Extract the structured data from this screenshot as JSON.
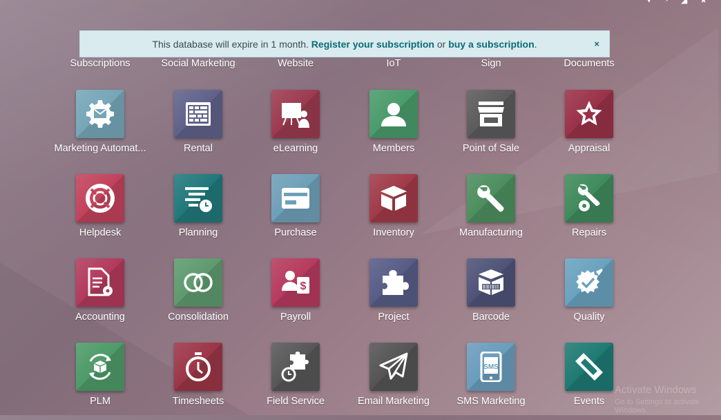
{
  "banner": {
    "text_before": "This database will expire in 1 month.",
    "register_link": "Register your subscription",
    "text_or": "or",
    "buy_link": "buy a subscription",
    "text_after": ".",
    "close": "×"
  },
  "top_row": [
    "Subscriptions",
    "Social Marketing",
    "Website",
    "IoT",
    "Sign",
    "Documents"
  ],
  "apps": [
    {
      "label": "Marketing Automat...",
      "color": "#75a6b8",
      "icon": "gear-envelope-icon"
    },
    {
      "label": "Rental",
      "color": "#5f6189",
      "icon": "calendar-grid-icon"
    },
    {
      "label": "eLearning",
      "color": "#9c3a4f",
      "icon": "presentation-icon"
    },
    {
      "label": "Members",
      "color": "#4a9b6b",
      "icon": "user-icon"
    },
    {
      "label": "Point of Sale",
      "color": "#5b5b5b",
      "icon": "store-icon"
    },
    {
      "label": "Appraisal",
      "color": "#9a3148",
      "icon": "star-icon"
    },
    {
      "label": "Helpdesk",
      "color": "#c2425b",
      "icon": "lifebuoy-icon"
    },
    {
      "label": "Planning",
      "color": "#21787b",
      "icon": "planning-clock-icon"
    },
    {
      "label": "Purchase",
      "color": "#6e9fb8",
      "icon": "credit-card-icon"
    },
    {
      "label": "Inventory",
      "color": "#a03a48",
      "icon": "box-icon"
    },
    {
      "label": "Manufacturing",
      "color": "#4c8e5e",
      "icon": "wrench-icon"
    },
    {
      "label": "Repairs",
      "color": "#3f8a5c",
      "icon": "wrench-gear-icon"
    },
    {
      "label": "Accounting",
      "color": "#b23a5c",
      "icon": "document-gear-icon"
    },
    {
      "label": "Consolidation",
      "color": "#5e9a6e",
      "icon": "overlap-circles-icon"
    },
    {
      "label": "Payroll",
      "color": "#b63a5e",
      "icon": "user-dollar-icon"
    },
    {
      "label": "Project",
      "color": "#575c86",
      "icon": "puzzle-icon"
    },
    {
      "label": "Barcode",
      "color": "#4e5377",
      "icon": "barcode-box-icon"
    },
    {
      "label": "Quality",
      "color": "#6aa2bf",
      "icon": "badge-check-icon"
    },
    {
      "label": "PLM",
      "color": "#4d9a68",
      "icon": "cycle-box-icon"
    },
    {
      "label": "Timesheets",
      "color": "#9b3547",
      "icon": "stopwatch-icon"
    },
    {
      "label": "Field Service",
      "color": "#575757",
      "icon": "puzzle-timer-icon"
    },
    {
      "label": "Email Marketing",
      "color": "#545454",
      "icon": "paper-plane-icon"
    },
    {
      "label": "SMS Marketing",
      "color": "#6a9cbc",
      "icon": "phone-sms-icon"
    },
    {
      "label": "Events",
      "color": "#1e7a73",
      "icon": "ticket-icon"
    }
  ],
  "sms_text": "SMS",
  "watermark": {
    "line1": "Activate Windows",
    "line2": "Go to Settings to activate Windows."
  }
}
